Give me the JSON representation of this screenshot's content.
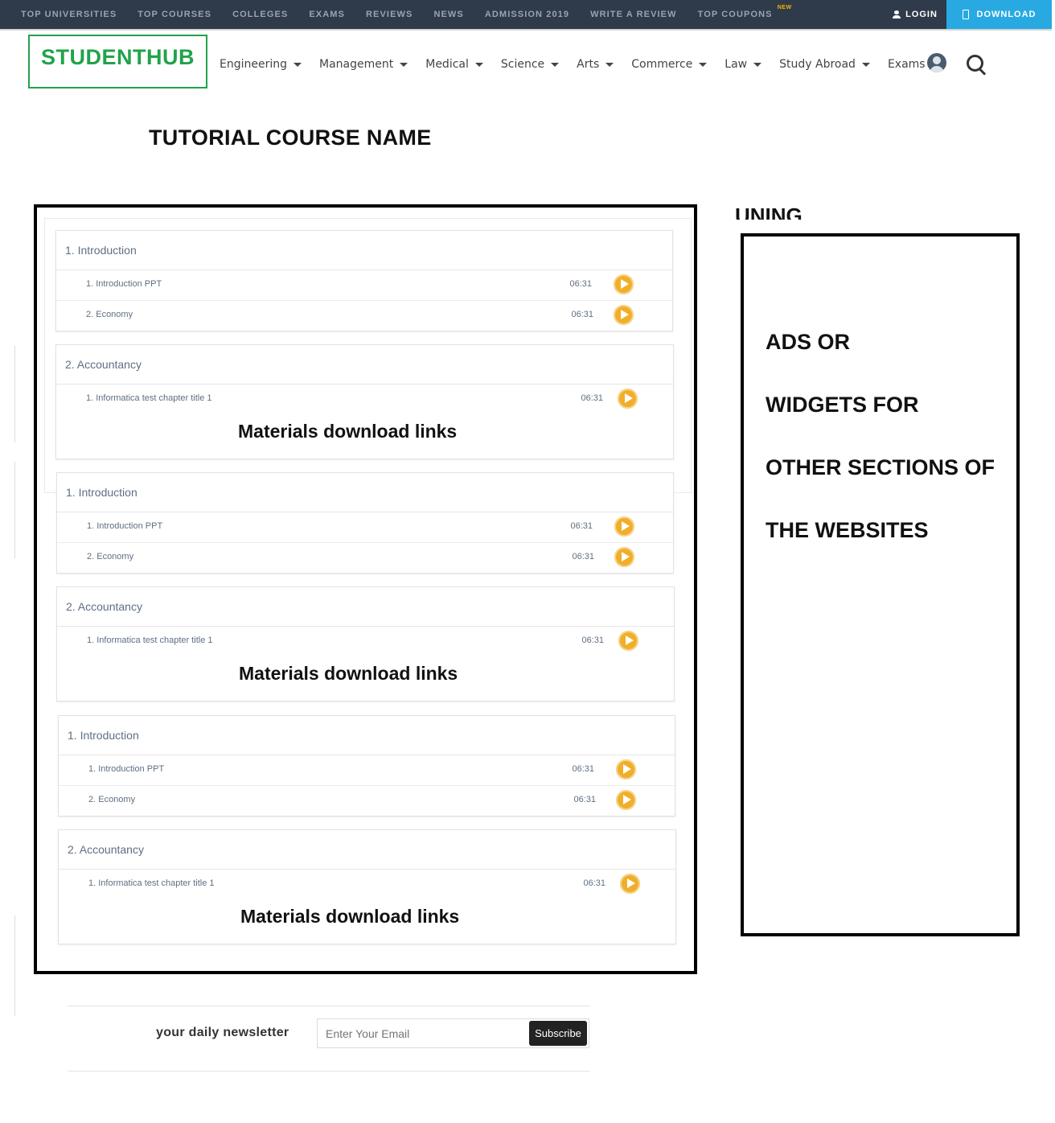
{
  "topbar": {
    "items": [
      "TOP UNIVERSITIES",
      "TOP COURSES",
      "COLLEGES",
      "EXAMS",
      "REVIEWS",
      "NEWS",
      "ADMISSION 2019",
      "WRITE A REVIEW",
      "TOP COUPONS"
    ],
    "new_badge": "NEW",
    "login": "LOGIN",
    "download": "DOWNLOAD",
    "colors": {
      "bar": "#2f3b4b",
      "download": "#29a9e1",
      "badge": "#f0b400"
    }
  },
  "header": {
    "logo": "STUDENTHUB",
    "logo_color": "#21a34a",
    "nav": [
      "Engineering",
      "Management",
      "Medical",
      "Science",
      "Arts",
      "Commerce",
      "Law",
      "Study Abroad",
      "Exams"
    ],
    "icons": [
      "user-avatar-icon",
      "search-icon"
    ]
  },
  "page": {
    "title": "TUTORIAL COURSE NAME"
  },
  "course": {
    "groups": [
      {
        "sections": [
          {
            "title": "1. Introduction",
            "lessons": [
              {
                "title": "1. Introduction PPT",
                "time": "06:31"
              },
              {
                "title": "2. Economy",
                "time": "06:31"
              }
            ]
          },
          {
            "title": "2. Accountancy",
            "lessons": [
              {
                "title": "1. Informatica test chapter title 1",
                "time": "06:31"
              }
            ]
          }
        ],
        "materials": "Materials download links"
      },
      {
        "sections": [
          {
            "title": "1. Introduction",
            "lessons": [
              {
                "title": "1. Introduction PPT",
                "time": "06:31"
              },
              {
                "title": "2. Economy",
                "time": "06:31"
              }
            ]
          },
          {
            "title": "2. Accountancy",
            "lessons": [
              {
                "title": "1. Informatica test chapter title 1",
                "time": "06:31"
              }
            ]
          }
        ],
        "materials": "Materials download links"
      },
      {
        "sections": [
          {
            "title": "1. Introduction",
            "lessons": [
              {
                "title": "1. Introduction PPT",
                "time": "06:31"
              },
              {
                "title": "2. Economy",
                "time": "06:31"
              }
            ]
          },
          {
            "title": "2. Accountancy",
            "lessons": [
              {
                "title": "1. Informatica test chapter title 1",
                "time": "06:31"
              }
            ]
          }
        ],
        "materials": "Materials download links"
      }
    ],
    "play_color": "#f0ae29"
  },
  "sidebar": {
    "cutoff_text": "UNING",
    "ad_lines": [
      "ADS OR",
      "WIDGETS FOR",
      "OTHER SECTIONS OF",
      "THE WEBSITES"
    ]
  },
  "newsletter": {
    "label": "your daily newsletter",
    "placeholder": "Enter Your Email",
    "button": "Subscribe"
  }
}
